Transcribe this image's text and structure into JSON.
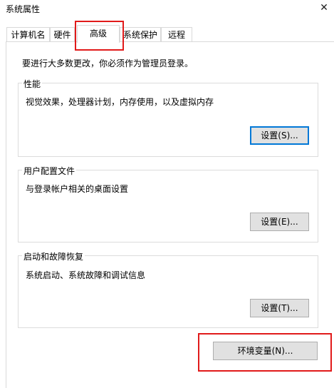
{
  "window": {
    "title": "系统属性",
    "close_glyph": "✕"
  },
  "tabs": [
    {
      "label": "计算机名"
    },
    {
      "label": "硬件"
    },
    {
      "label": "高级",
      "active": true
    },
    {
      "label": "系统保护"
    },
    {
      "label": "远程"
    }
  ],
  "advanced": {
    "admin_note": "要进行大多数更改，你必须作为管理员登录。",
    "performance": {
      "title": "性能",
      "description": "视觉效果，处理器计划，内存使用，以及虚拟内存",
      "button": "设置(S)..."
    },
    "user_profiles": {
      "title": "用户配置文件",
      "description": "与登录帐户相关的桌面设置",
      "button": "设置(E)..."
    },
    "startup_recovery": {
      "title": "启动和故障恢复",
      "description": "系统启动、系统故障和调试信息",
      "button": "设置(T)..."
    },
    "env_button": "环境变量(N)..."
  },
  "colors": {
    "highlight": "#e11a1a",
    "focus_border": "#0078d7",
    "button_face": "#e1e1e1"
  }
}
